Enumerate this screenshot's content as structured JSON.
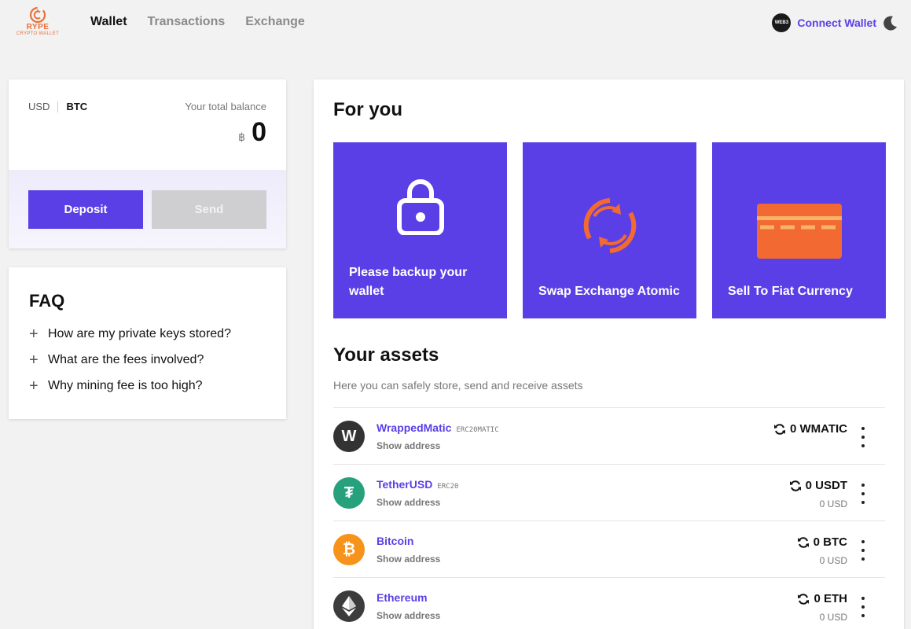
{
  "header": {
    "logo": {
      "line1": "RYPE",
      "line2": "CRYPTO WALLET",
      "color": "#e8703a"
    },
    "nav": [
      {
        "label": "Wallet",
        "active": true
      },
      {
        "label": "Transactions",
        "active": false
      },
      {
        "label": "Exchange",
        "active": false
      }
    ],
    "connect": {
      "badge": "WEB3",
      "label": "Connect Wallet"
    },
    "theme_icon": "moon-icon"
  },
  "balance": {
    "currencies": [
      "USD",
      "BTC"
    ],
    "active_currency": "BTC",
    "total_label": "Your total balance",
    "symbol": "฿",
    "value": "0",
    "deposit_label": "Deposit",
    "send_label": "Send"
  },
  "faq": {
    "title": "FAQ",
    "items": [
      "How are my private keys stored?",
      "What are the fees involved?",
      "Why mining fee is too high?"
    ]
  },
  "for_you": {
    "title": "For you",
    "tiles": [
      {
        "label": "Please backup your wallet",
        "icon": "lock-icon"
      },
      {
        "label": "Swap Exchange Atomic",
        "icon": "swap-icon"
      },
      {
        "label": "Sell To Fiat Currency",
        "icon": "card-icon"
      }
    ]
  },
  "assets": {
    "title": "Your assets",
    "subtitle": "Here you can safely store, send and receive assets",
    "show_address": "Show address",
    "rows": [
      {
        "name": "WrappedMatic",
        "tag": "ERC20MATIC",
        "amount": "0 WMATIC",
        "usd": "",
        "icon": "wmatic-icon",
        "glyph": "W",
        "color": "#333333"
      },
      {
        "name": "TetherUSD",
        "tag": "ERC20",
        "amount": "0 USDT",
        "usd": "0 USD",
        "icon": "tether-icon",
        "glyph": "₮",
        "color": "#26a17b"
      },
      {
        "name": "Bitcoin",
        "tag": "",
        "amount": "0 BTC",
        "usd": "0 USD",
        "icon": "bitcoin-icon",
        "glyph": "₿",
        "color": "#f7931a"
      },
      {
        "name": "Ethereum",
        "tag": "",
        "amount": "0 ETH",
        "usd": "0 USD",
        "icon": "ethereum-icon",
        "glyph": "",
        "color": "#3c3c3d"
      }
    ]
  },
  "colors": {
    "accent": "#5b3fe6",
    "orange": "#f26a32"
  }
}
